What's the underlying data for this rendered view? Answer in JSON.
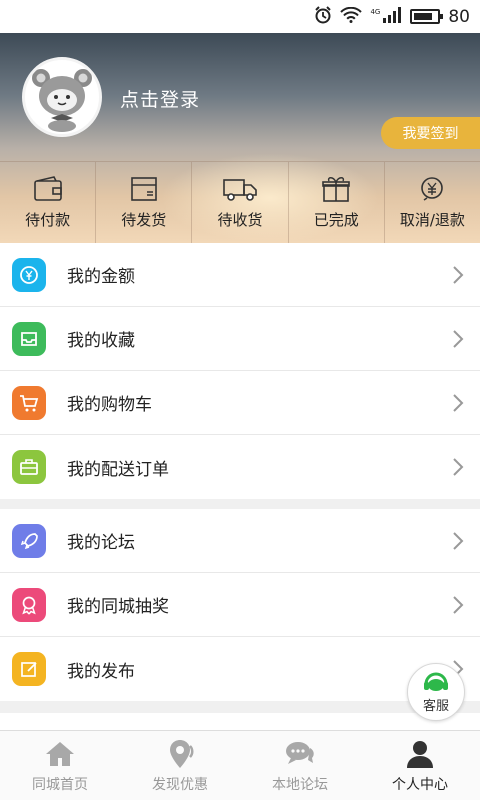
{
  "status_bar": {
    "icons": [
      "alarm-icon",
      "wifi-icon",
      "signal-icon",
      "battery-icon"
    ],
    "network_label": "4G",
    "battery_percent": "80",
    "battery_level": 0.8
  },
  "profile": {
    "login_text": "点击登录",
    "signin_button": "我要签到"
  },
  "orders": [
    {
      "label": "待付款",
      "icon": "wallet-icon"
    },
    {
      "label": "待发货",
      "icon": "box-icon"
    },
    {
      "label": "待收货",
      "icon": "truck-icon"
    },
    {
      "label": "已完成",
      "icon": "gift-icon"
    },
    {
      "label": "取消/退款",
      "icon": "refund-icon"
    }
  ],
  "menu_group_1": [
    {
      "label": "我的金额",
      "icon": "yen-coin-icon",
      "color": "#1bb4ec"
    },
    {
      "label": "我的收藏",
      "icon": "inbox-icon",
      "color": "#3dbb5b"
    },
    {
      "label": "我的购物车",
      "icon": "cart-icon",
      "color": "#f07a2f"
    },
    {
      "label": "我的配送订单",
      "icon": "briefcase-icon",
      "color": "#8cc63e"
    }
  ],
  "menu_group_2": [
    {
      "label": "我的论坛",
      "icon": "rocket-icon",
      "color": "#6f7de8"
    },
    {
      "label": "我的同城抽奖",
      "icon": "award-icon",
      "color": "#ec4a7a"
    },
    {
      "label": "我的发布",
      "icon": "edit-icon",
      "color": "#f4b421"
    }
  ],
  "customer_service": {
    "label": "客服",
    "color": "#2db84a"
  },
  "tabbar": [
    {
      "label": "同城首页",
      "icon": "home-icon",
      "active": false
    },
    {
      "label": "发现优惠",
      "icon": "location-icon",
      "active": false
    },
    {
      "label": "本地论坛",
      "icon": "chat-icon",
      "active": false
    },
    {
      "label": "个人中心",
      "icon": "user-icon",
      "active": true
    }
  ],
  "colors": {
    "accent_gold": "#e8b43c",
    "tab_inactive": "#999999",
    "tab_active": "#222222"
  }
}
